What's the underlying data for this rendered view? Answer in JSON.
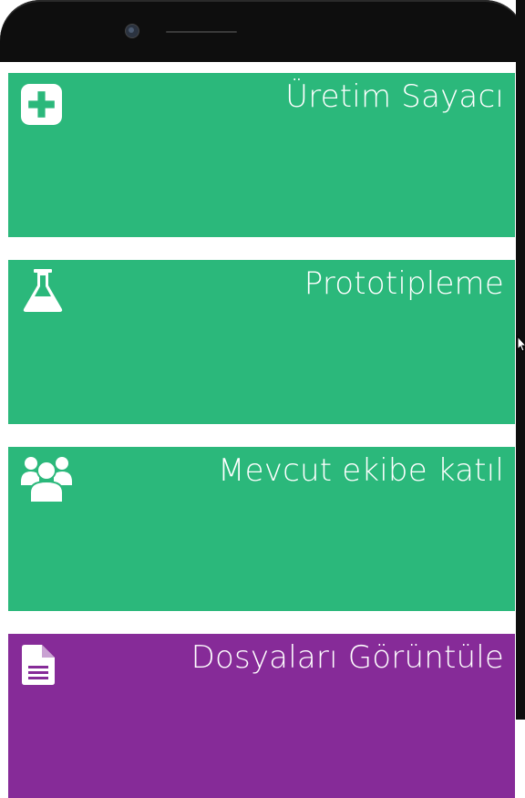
{
  "tiles": [
    {
      "title": "Üretim Sayacı",
      "icon": "plus-square-icon",
      "color": "#2bb87b"
    },
    {
      "title": "Prototipleme",
      "icon": "flask-icon",
      "color": "#2bb87b"
    },
    {
      "title": "Mevcut ekibe katıl",
      "icon": "users-icon",
      "color": "#2bb87b"
    },
    {
      "title": "Dosyaları Görüntüle",
      "icon": "file-icon",
      "color": "#862b98"
    }
  ]
}
